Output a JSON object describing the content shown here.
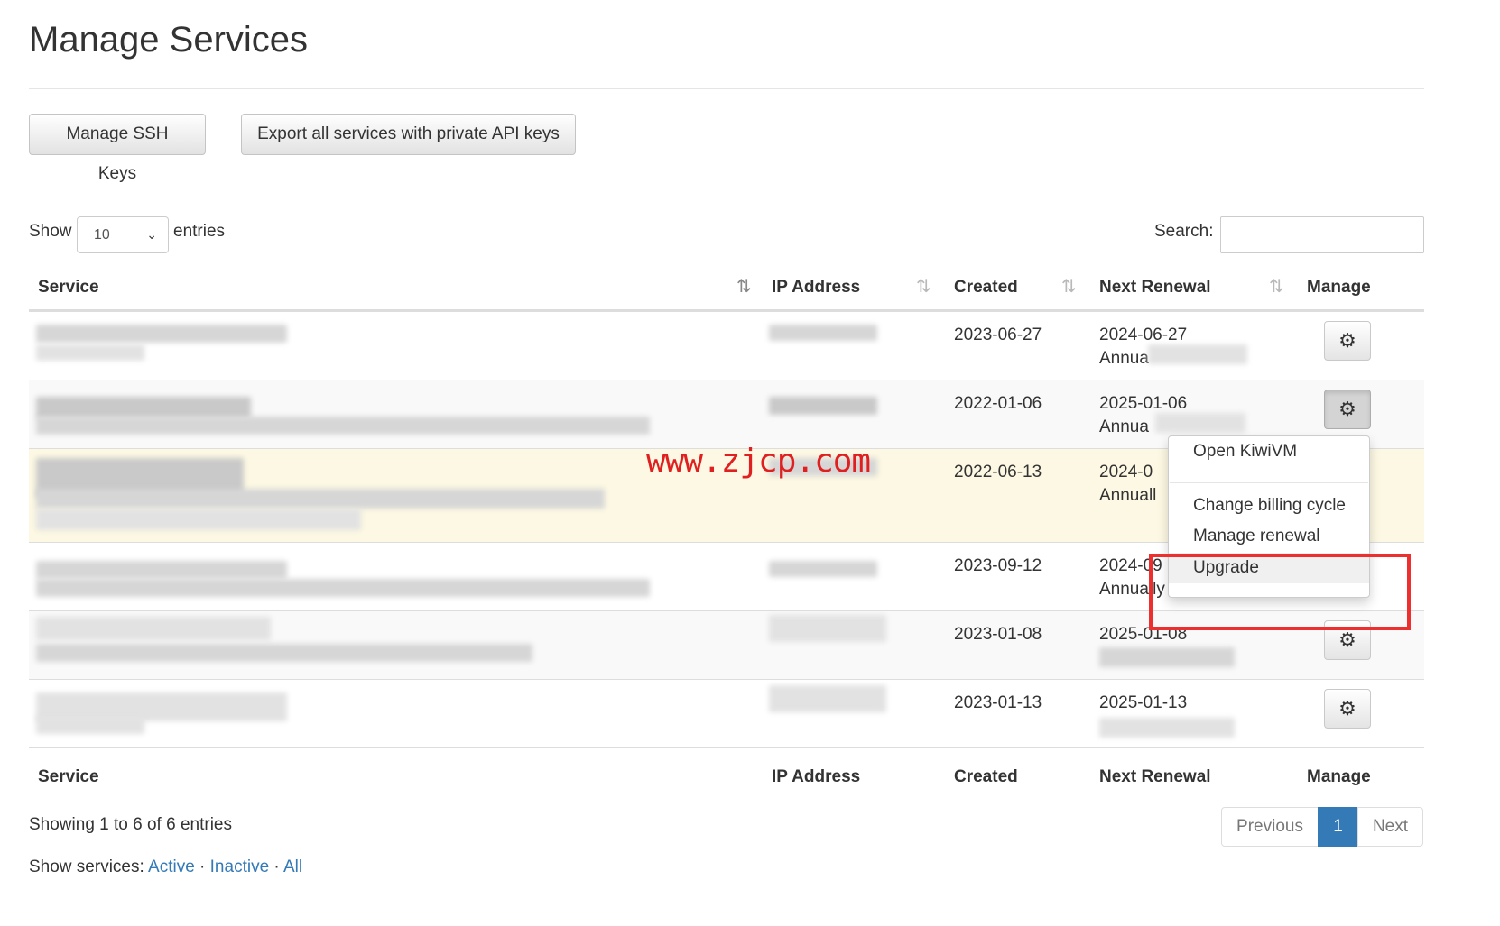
{
  "page": {
    "title": "Manage Services"
  },
  "toolbar": {
    "ssh_keys_label": "Manage SSH Keys",
    "export_label": "Export all services with private API keys"
  },
  "length_menu": {
    "show_label": "Show",
    "value": "10",
    "entries_label": "entries"
  },
  "search": {
    "label": "Search:",
    "value": ""
  },
  "table": {
    "columns": [
      "Service",
      "IP Address",
      "Created",
      "Next Renewal",
      "Manage"
    ],
    "rows": [
      {
        "created": "2023-06-27",
        "renewal_date": "2024-06-27",
        "renewal_cycle": "Annua"
      },
      {
        "created": "2022-01-06",
        "renewal_date": "2025-01-06",
        "renewal_cycle": "Annua"
      },
      {
        "created": "2022-06-13",
        "renewal_date": "2024-0",
        "renewal_cycle": "Annuall"
      },
      {
        "created": "2023-09-12",
        "renewal_date": "2024-09",
        "renewal_cycle": "Annually"
      },
      {
        "created": "2023-01-08",
        "renewal_date": "2025-01-08",
        "renewal_cycle": ""
      },
      {
        "created": "2023-01-13",
        "renewal_date": "2025-01-13",
        "renewal_cycle": ""
      }
    ]
  },
  "dropdown": {
    "items": [
      "Open KiwiVM",
      "Change billing cycle",
      "Manage renewal",
      "Upgrade"
    ]
  },
  "watermark": "www.zjcp.com",
  "info": "Showing 1 to 6 of 6 entries",
  "pagination": {
    "previous": "Previous",
    "current": "1",
    "next": "Next"
  },
  "show_services": {
    "label": "Show services:",
    "active": "Active",
    "inactive": "Inactive",
    "all": "All",
    "separator": "·"
  },
  "colors": {
    "link": "#337ab7",
    "highlight_row": "#fcf8e3",
    "annotation": "#ee2f2f"
  }
}
